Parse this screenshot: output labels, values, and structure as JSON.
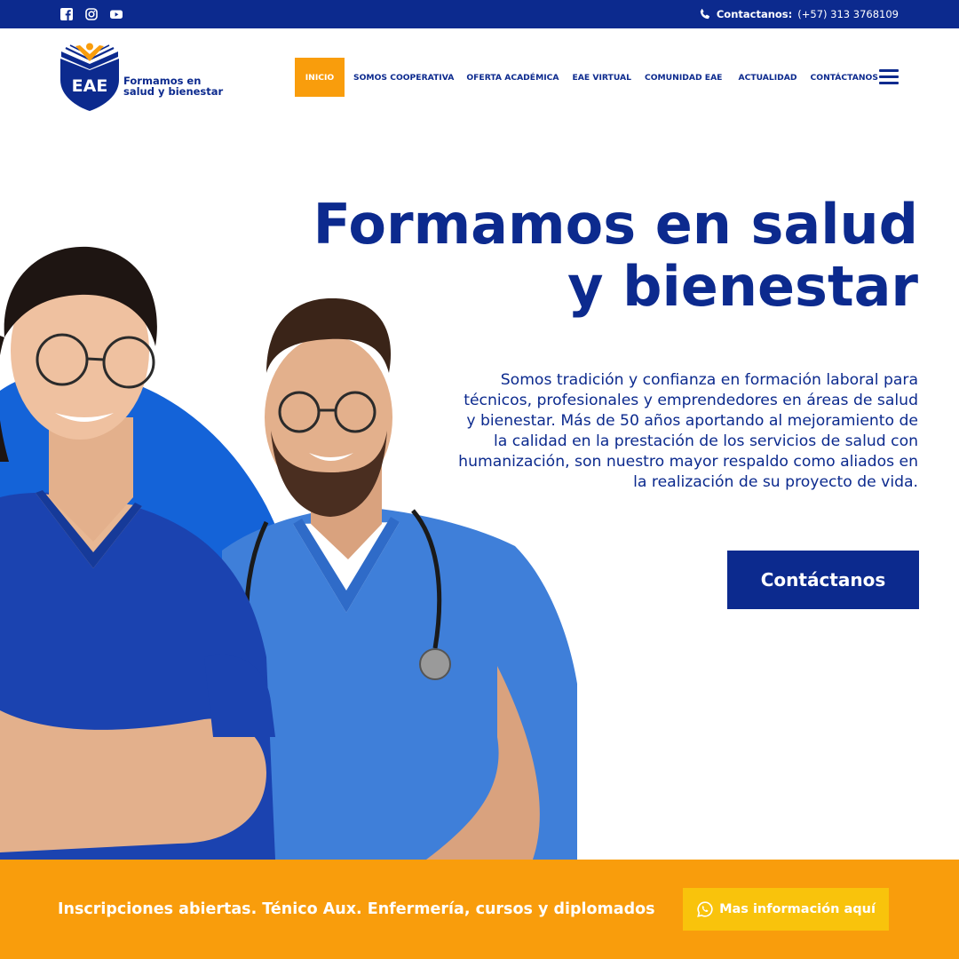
{
  "topbar": {
    "social": [
      "facebook-icon",
      "instagram-icon",
      "youtube-icon"
    ],
    "contact_label": "Contactanos:",
    "contact_phone": "(+57) 313 3768109"
  },
  "logo": {
    "initials": "EAE",
    "tagline": "Formamos en\nsalud y bienestar"
  },
  "nav": {
    "items": [
      {
        "label": "INICIO",
        "active": true
      },
      {
        "label": "SOMOS COOPERATIVA"
      },
      {
        "label": "OFERTA ACADÉMICA"
      },
      {
        "label": "EAE VIRTUAL"
      },
      {
        "label": "COMUNIDAD EAE"
      },
      {
        "label": "ACTUALIDAD"
      },
      {
        "label": "CONTÁCTANOS"
      }
    ],
    "menu_icon": "hamburger-menu-icon"
  },
  "hero": {
    "title_line1": "Formamos en salud",
    "title_line2": "y bienestar",
    "description": "Somos tradición y confianza en formación laboral para técnicos, profesionales y emprendedores en áreas de salud y bienestar. Más de 50 años aportando al mejoramiento de la calidad en la prestación de los servicios de salud con humanización, son nuestro mayor respaldo como aliados en la realización de su proyecto de vida.",
    "cta_label": "Contáctanos"
  },
  "banner": {
    "text": "Inscripciones abiertas. Ténico Aux. Enfermería, cursos y diplomados",
    "button_label": "Mas información aquí",
    "button_icon": "whatsapp-icon"
  },
  "colors": {
    "primary": "#0c2a8e",
    "accent_orange": "#f99d0c",
    "accent_yellow": "#f9c30c",
    "scrub_blue": "#3f7fd9"
  }
}
